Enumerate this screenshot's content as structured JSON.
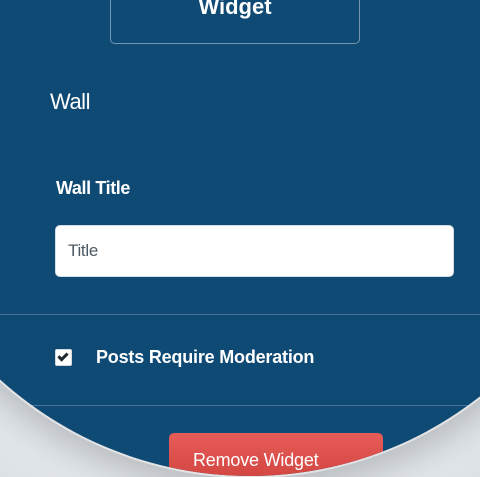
{
  "header": {
    "top_button_label": "Widget"
  },
  "widget": {
    "title": "Wall",
    "wall_title_label": "Wall Title",
    "wall_title_value": "Title",
    "moderation_label": "Posts Require Moderation",
    "moderation_checked": true,
    "remove_button_label": "Remove Widget"
  },
  "colors": {
    "panel_background": "#0f4a74",
    "danger_button": "#d9534f"
  },
  "icons": {
    "check": "checkmark"
  }
}
